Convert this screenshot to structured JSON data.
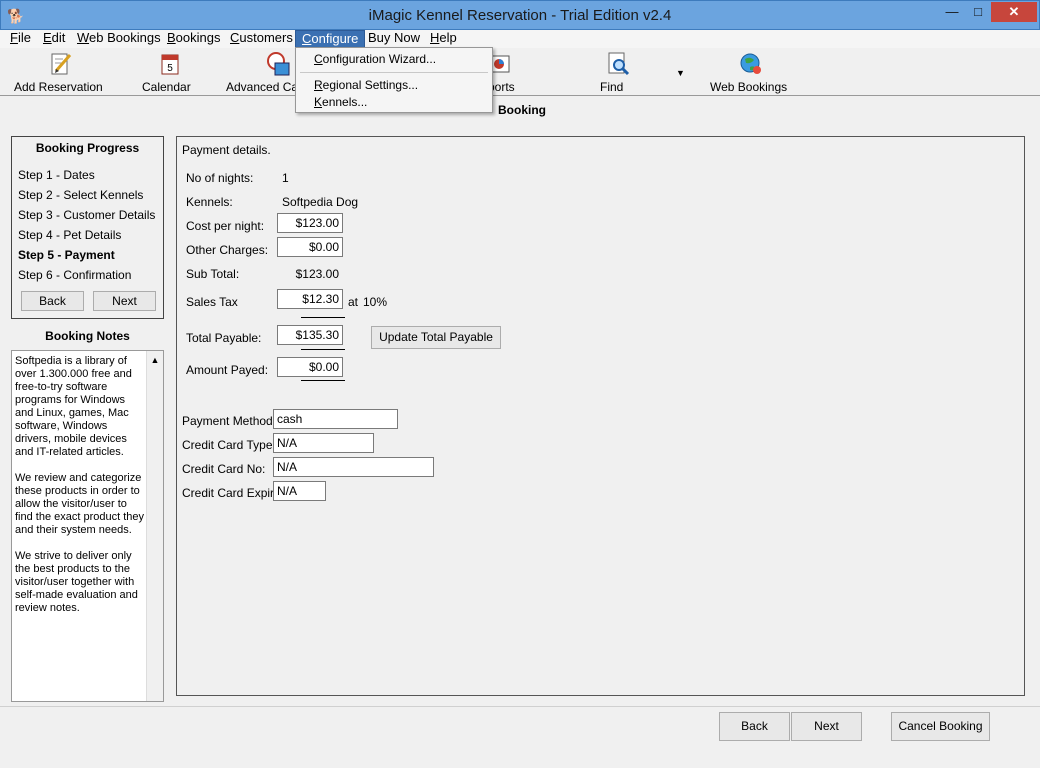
{
  "window": {
    "title": "iMagic Kennel Reservation - Trial Edition v2.4",
    "min": "—",
    "max": "□",
    "close": "✕"
  },
  "menu": [
    {
      "hot": "F",
      "rest": "ile"
    },
    {
      "hot": "E",
      "rest": "dit"
    },
    {
      "hot": "W",
      "rest": "eb Bookings"
    },
    {
      "hot": "B",
      "rest": "ookings"
    },
    {
      "hot": "C",
      "rest": "ustomers"
    },
    {
      "hot": "C",
      "rest": "onfigure"
    },
    {
      "hot": "",
      "rest": "Buy Now"
    },
    {
      "hot": "H",
      "rest": "elp"
    }
  ],
  "configure_menu": [
    {
      "hot": "C",
      "rest": "onfiguration Wizard..."
    },
    {
      "hot": "R",
      "rest": "egional Settings..."
    },
    {
      "hot": "K",
      "rest": "ennels..."
    }
  ],
  "toolbar": {
    "add_reservation": "Add Reservation",
    "calendar": "Calendar",
    "advanced": "Advanced Ca",
    "reports": "ports",
    "find": "Find",
    "web_bookings": "Web Bookings"
  },
  "page_heading": "Booking",
  "progress": {
    "title": "Booking Progress",
    "steps": [
      "Step 1 - Dates",
      "Step 2 - Select Kennels",
      "Step 3 - Customer Details",
      "Step 4 - Pet Details",
      "Step 5 - Payment",
      "Step 6 - Confirmation"
    ],
    "current_step": 5,
    "back": "Back",
    "next": "Next"
  },
  "notes": {
    "title": "Booking Notes",
    "text": "Softpedia is a library of over 1.300.000 free and free-to-try software programs for Windows and Linux, games, Mac software, Windows drivers, mobile devices and IT-related articles.\n\nWe review and categorize these products in order to allow the visitor/user to find the exact product they and their system needs.\n\nWe strive to deliver only the best products to the visitor/user together with self-made evaluation and review notes."
  },
  "payment": {
    "heading": "Payment details.",
    "nights_label": "No of nights:",
    "nights": "1",
    "kennels_label": "Kennels:",
    "kennels": "Softpedia Dog",
    "cost_label": "Cost per night:",
    "cost": "$123.00",
    "other_label": "Other Charges:",
    "other": "$0.00",
    "subtotal_label": "Sub Total:",
    "subtotal": "$123.00",
    "tax_label": "Sales Tax",
    "tax": "$12.30",
    "tax_at": "at",
    "tax_rate": "10%",
    "total_label": "Total Payable:",
    "total": "$135.30",
    "update_button": "Update Total Payable",
    "paid_label": "Amount Payed:",
    "paid": "$0.00",
    "method_label": "Payment Method:",
    "method": "cash",
    "card_type_label": "Credit Card Type:",
    "card_type": "N/A",
    "card_no_label": "Credit Card No:",
    "card_no": "N/A",
    "card_expiry_label": "Credit Card Expiry:",
    "card_expiry": "N/A"
  },
  "footer": {
    "back": "Back",
    "next": "Next",
    "cancel": "Cancel Booking"
  }
}
